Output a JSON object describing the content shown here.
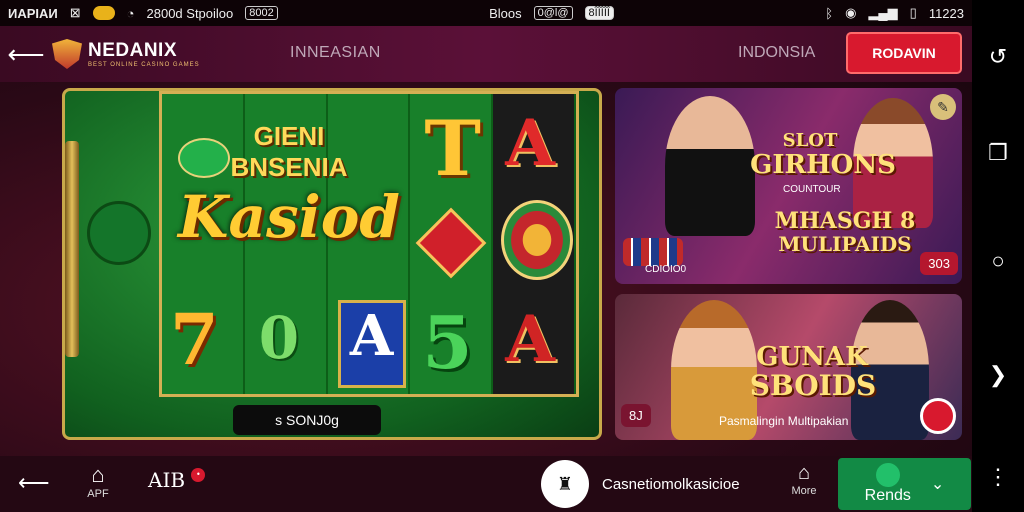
{
  "status_bar": {
    "left_text": "ИAPIAИ",
    "chip1": "8002",
    "network": "2800d Stpoiloo",
    "middle_chip": "Bloos",
    "middle_chip2": "0@l@",
    "pill": "8ÎÎÎÎÎ",
    "time": "11223"
  },
  "header": {
    "brand": "NEDANIX",
    "brand_sub": "BEST ONLINE CASINO GAMES",
    "nav_center": "INNEASIAN",
    "nav_right": "INDONSIA",
    "cta": "RODAVIN"
  },
  "game": {
    "title_top": "GIENI",
    "title_mid": "BNSENIA",
    "logo_text": "Kasiod",
    "bet_label": "s SONJ0g"
  },
  "card1": {
    "title1": "SLOT",
    "title2": "GIRHONS",
    "sub": "COUNTOUR",
    "title3": "MHASGH 8",
    "title4": "MULIPAIDS",
    "chips_label": "CDIOIO0",
    "badge": "303"
  },
  "card2": {
    "title1": "GUNAK",
    "title2": "SBOIDS",
    "sub": "Pasmalingin Multipakian",
    "badge": "8J"
  },
  "bottom_bar": {
    "item1_label": "APF",
    "item2_label": "AIB",
    "item2_badge": "•",
    "center_label": "Casnetiomolkasicioe",
    "more_label": "More",
    "green_label": "Rends"
  },
  "colors": {
    "accent_red": "#d8192e",
    "accent_green": "#128a45",
    "gold": "#c8a94a"
  }
}
